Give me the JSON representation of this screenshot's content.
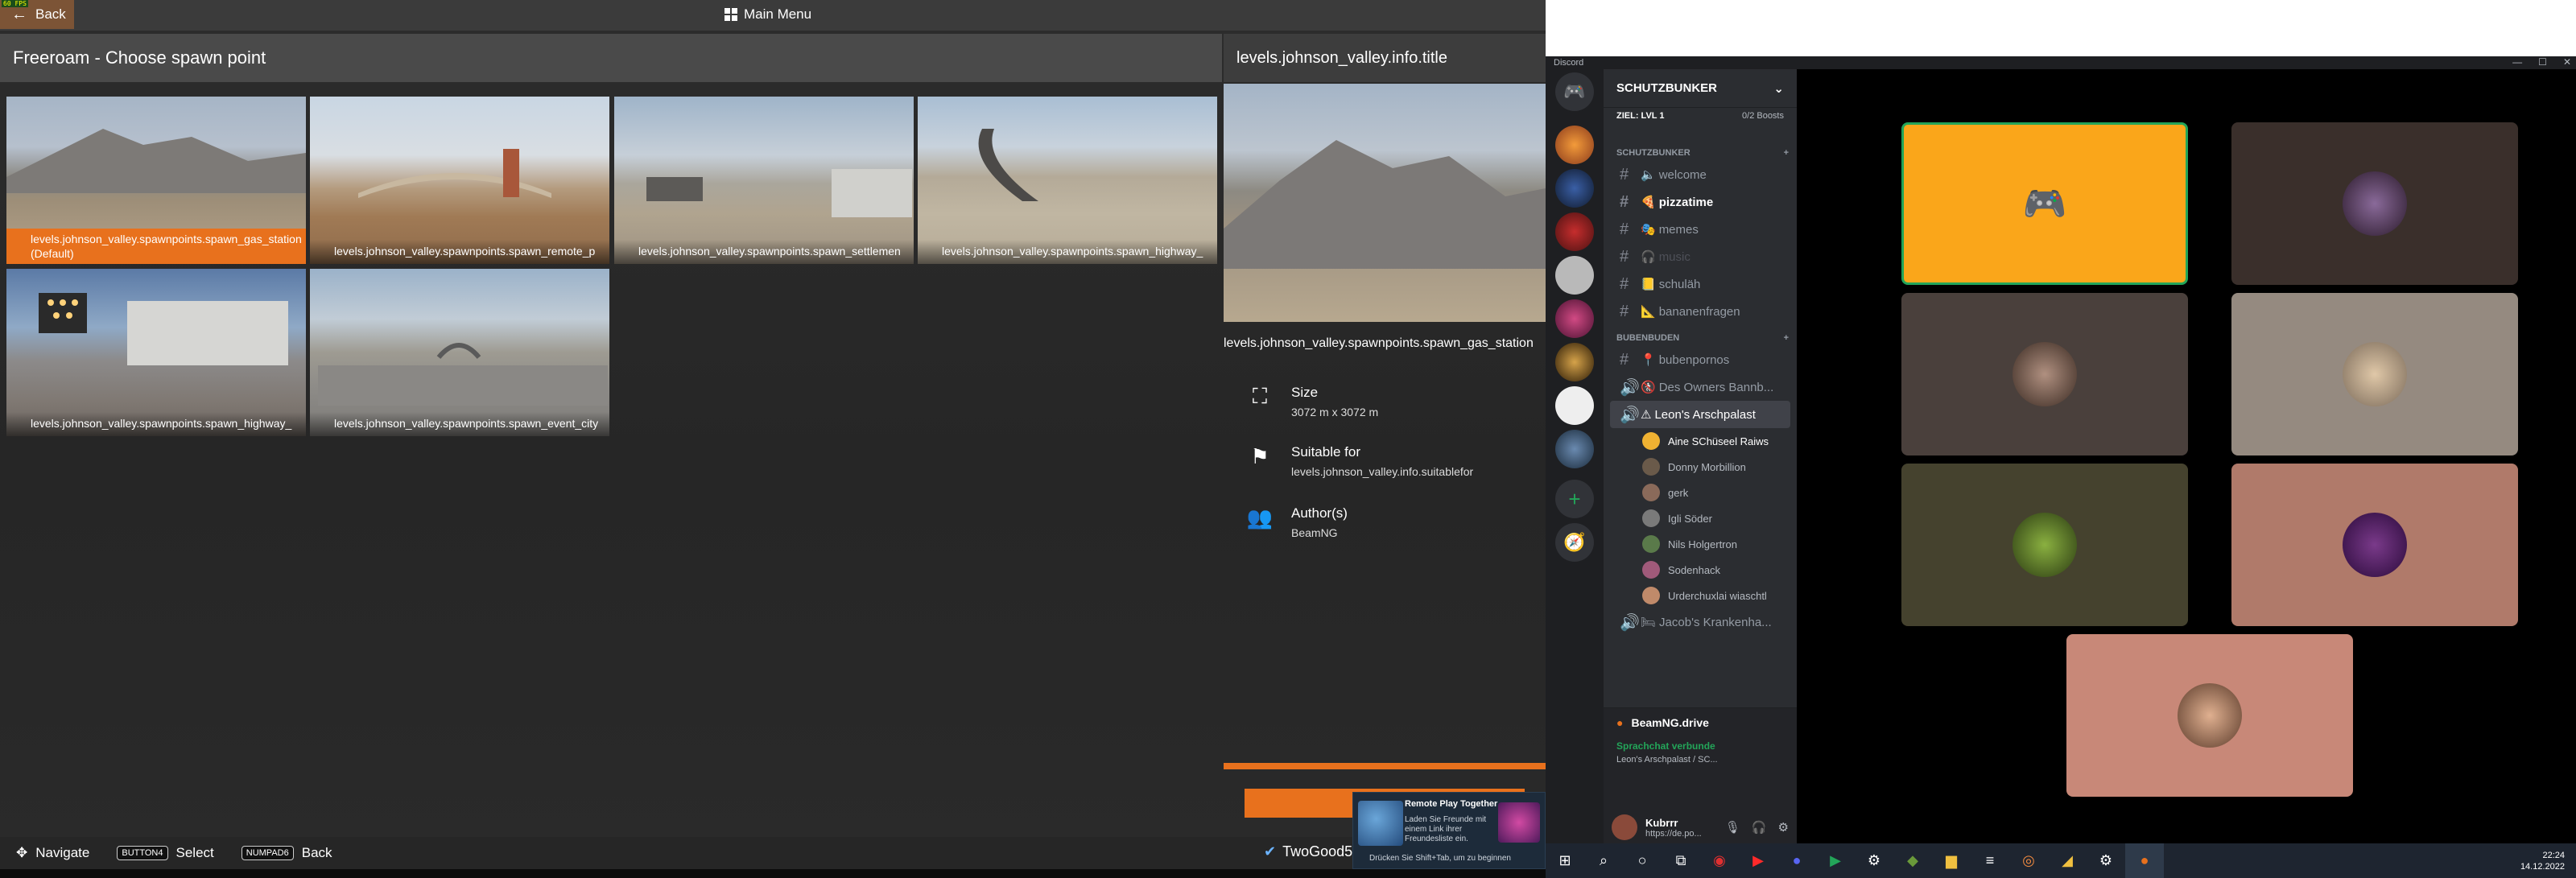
{
  "game": {
    "fps": "60 FPS",
    "back": "Back",
    "main_menu": "Main Menu",
    "title": "Freeroam - Choose spawn point",
    "tiles": [
      {
        "label": "levels.johnson_valley.spawnpoints.spawn_gas_station",
        "sub": "(Default)"
      },
      {
        "label": "levels.johnson_valley.spawnpoints.spawn_remote_p"
      },
      {
        "label": "levels.johnson_valley.spawnpoints.spawn_settlemen"
      },
      {
        "label": "levels.johnson_valley.spawnpoints.spawn_highway_"
      },
      {
        "label": "levels.johnson_valley.spawnpoints.spawn_highway_"
      },
      {
        "label": "levels.johnson_valley.spawnpoints.spawn_event_city"
      }
    ],
    "details": {
      "title": "levels.johnson_valley.info.title",
      "spawn_name": "levels.johnson_valley.spawnpoints.spawn_gas_station",
      "size_label": "Size",
      "size_value": "3072 m x 3072 m",
      "suitable_label": "Suitable for",
      "suitable_value": "levels.johnson_valley.info.suitablefor",
      "author_label": "Author(s)",
      "author_value": "BeamNG"
    },
    "hints": {
      "navigate": "Navigate",
      "select_key": "BUTTON4",
      "select": "Select",
      "back_key": "NUMPAD6",
      "back": "Back"
    },
    "user": "TwoGood5",
    "toast": {
      "title": "Remote Play Together",
      "body": "Laden Sie Freunde mit einem Link ihrer Freundesliste ein.",
      "hint": "Drücken Sie Shift+Tab, um zu beginnen"
    }
  },
  "discord": {
    "app": "Discord",
    "server": "SCHUTZBUNKER",
    "boost_goal": "ZIEL: LVL 1",
    "boosts": "0/2 Boosts",
    "cat1": "SCHUTZBUNKER",
    "channels1": [
      {
        "name": "welcome",
        "emoji": "🔈"
      },
      {
        "name": "pizzatime",
        "emoji": "🍕"
      },
      {
        "name": "memes",
        "emoji": "🎭"
      },
      {
        "name": "music",
        "emoji": "🎧"
      },
      {
        "name": "schuläh",
        "emoji": "📒"
      },
      {
        "name": "bananenfragen",
        "emoji": "📐"
      }
    ],
    "cat2": "BUBENBUDEN",
    "channels2": [
      {
        "name": "bubenpornos",
        "emoji": "📍"
      },
      {
        "name": "Des Owners Bannb...",
        "emoji": "🚷"
      },
      {
        "name": "Leon's Arschpalast",
        "emoji": "⚠"
      }
    ],
    "members": [
      "Aine SChüseel Raiws",
      "Donny Morbillion",
      "gerk",
      "Igli Söder",
      "Nils Holgertron",
      "Sodenhack",
      "Urderchuxlai wiaschtl"
    ],
    "channel_last": "Jacob's Krankenha...",
    "activity": "BeamNG.drive",
    "voice_status": "Sprachchat verbunde",
    "voice_channel": "Leon's Arschpalast / SC...",
    "username": "Kubrrr",
    "user_sub": "https://de.po...",
    "colors": {
      "accent": "#faa61a",
      "green": "#23a559"
    }
  },
  "clock": {
    "time": "22:24",
    "date": "14.12.2022"
  }
}
